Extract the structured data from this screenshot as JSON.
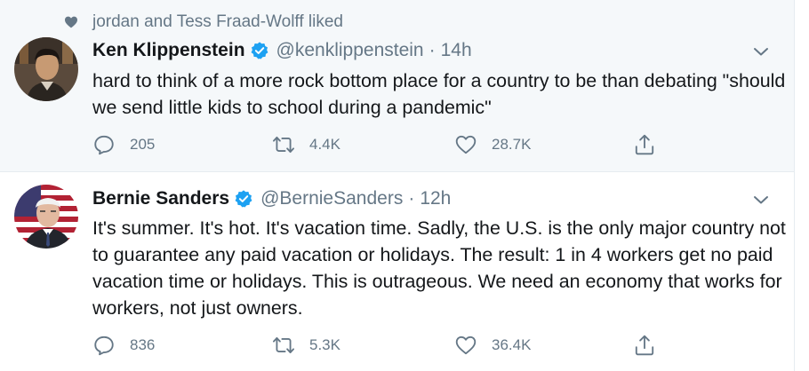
{
  "social_context": {
    "text": "jordan and Tess Fraad-Wolff liked",
    "icon": "heart-icon"
  },
  "tweets": [
    {
      "name": "Ken Klippenstein",
      "handle": "@kenklippenstein",
      "separator": "·",
      "time": "14h",
      "verified": true,
      "text": "hard to think of a more rock bottom place for a country to be than debating \"should we send little kids to school during a pandemic\"",
      "replies": "205",
      "retweets": "4.4K",
      "likes": "28.7K"
    },
    {
      "name": "Bernie Sanders",
      "handle": "@BernieSanders",
      "separator": "·",
      "time": "12h",
      "verified": true,
      "text": "It's summer. It's hot. It's vacation time. Sadly, the U.S. is the only major country not to guarantee any paid vacation or holidays. The result: 1 in 4 workers get no paid vacation time or holidays. This is outrageous. We need an economy that works for workers, not just owners.",
      "replies": "836",
      "retweets": "5.3K",
      "likes": "36.4K"
    }
  ],
  "colors": {
    "highlight_bg": "#f5f8fa",
    "secondary_text": "#657786",
    "verified_blue": "#1da1f2",
    "primary_text": "#14171a"
  }
}
